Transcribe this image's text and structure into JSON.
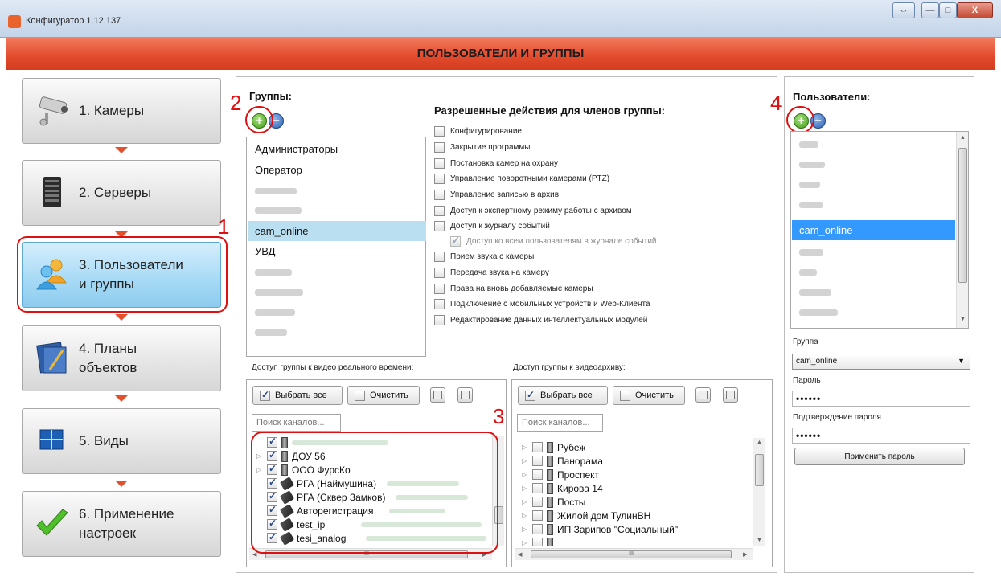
{
  "window": {
    "title": "Конфигуратор 1.12.137",
    "buttons": {
      "restore": "⇔",
      "minimize": "—",
      "maximize": "□",
      "close": "X"
    }
  },
  "header": {
    "title": "ПОЛЬЗОВАТЕЛИ И ГРУППЫ"
  },
  "nav": [
    {
      "label": "1. Камеры",
      "icon": "camera-icon"
    },
    {
      "label": "2. Серверы",
      "icon": "server-icon"
    },
    {
      "label": "3. Пользователи и группы",
      "label_line1": "3. Пользователи",
      "label_line2": "и группы",
      "icon": "users-icon",
      "active": true
    },
    {
      "label": "4. Планы объектов",
      "label_line1": "4. Планы",
      "label_line2": "объектов",
      "icon": "map-icon"
    },
    {
      "label": "5. Виды",
      "icon": "layout-icon"
    },
    {
      "label": "6. Применение настроек",
      "label_line1": "6. Применение",
      "label_line2": "настроек",
      "icon": "checkmark-icon"
    }
  ],
  "annotations": {
    "n1": "1",
    "n2": "2",
    "n3": "3",
    "n4": "4"
  },
  "groups": {
    "title": "Группы:",
    "add_label": "+",
    "remove_label": "−",
    "items": [
      "Администраторы",
      "Оператор",
      "",
      "",
      "cam_online",
      "УВД",
      "",
      "",
      "",
      ""
    ],
    "selected": "cam_online"
  },
  "permissions": {
    "title": "Разрешенные действия для членов группы:",
    "items": [
      {
        "label": "Конфигурирование",
        "checked": false
      },
      {
        "label": "Закрытие программы",
        "checked": false
      },
      {
        "label": "Постановка камер на охрану",
        "checked": false
      },
      {
        "label": "Управление поворотными камерами (PTZ)",
        "checked": false
      },
      {
        "label": "Управление записью в архив",
        "checked": false
      },
      {
        "label": "Доступ к экспертному режиму работы с архивом",
        "checked": false
      },
      {
        "label": "Доступ к журналу событий",
        "checked": false
      },
      {
        "label": "Доступ ко всем пользователям в журнале событий",
        "checked": true,
        "disabled": true
      },
      {
        "label": "Прием звука с камеры",
        "checked": false
      },
      {
        "label": "Передача звука на камеру",
        "checked": false
      },
      {
        "label": "Права на вновь добавляемые камеры",
        "checked": false
      },
      {
        "label": "Подключение с мобильных устройств и Web-Клиента",
        "checked": false
      },
      {
        "label": "Редактирование данных интеллектуальных модулей",
        "checked": false
      }
    ]
  },
  "live_access": {
    "title": "Доступ группы к видео реального времени:",
    "select_all": "Выбрать все",
    "clear": "Очистить",
    "search_placeholder": "Поиск каналов...",
    "channels": [
      {
        "label": "ДОУ 56",
        "type": "server",
        "checked": true
      },
      {
        "label": "ООО ФурсКо",
        "type": "server",
        "checked": true
      },
      {
        "label": "РГА (Наймушина)",
        "type": "camera",
        "checked": true
      },
      {
        "label": "РГА (Сквер Замков)",
        "type": "camera",
        "checked": true
      },
      {
        "label": "Авторегистрация",
        "type": "camera",
        "checked": true
      },
      {
        "label": "test_ip",
        "type": "camera",
        "checked": true
      },
      {
        "label": "tesi_analog",
        "type": "camera",
        "checked": true
      }
    ]
  },
  "archive_access": {
    "title": "Доступ группы к видеоархиву:",
    "select_all": "Выбрать все",
    "clear": "Очистить",
    "search_placeholder": "Поиск каналов...",
    "channels": [
      {
        "label": "Рубеж",
        "checked": false
      },
      {
        "label": "Панорама",
        "checked": false
      },
      {
        "label": "Проспект",
        "checked": false
      },
      {
        "label": "Кирова 14",
        "checked": false
      },
      {
        "label": "Посты",
        "checked": false
      },
      {
        "label": "Жилой дом ТулинВН",
        "checked": false
      },
      {
        "label": "ИП Зарипов \"Социальный\"",
        "checked": false
      }
    ]
  },
  "users": {
    "title": "Пользователи:",
    "add_label": "+",
    "remove_label": "−",
    "items": [
      "",
      "",
      "",
      "",
      "cam_online",
      "",
      "",
      "",
      ""
    ],
    "selected": "cam_online"
  },
  "user_form": {
    "group_label": "Группа",
    "group_value": "cam_online",
    "password_label": "Пароль",
    "password_value": "••••••",
    "confirm_label": "Подтверждение пароля",
    "confirm_value": "••••••",
    "apply_label": "Применить пароль"
  },
  "scroll": {
    "h_thumb": "III"
  }
}
